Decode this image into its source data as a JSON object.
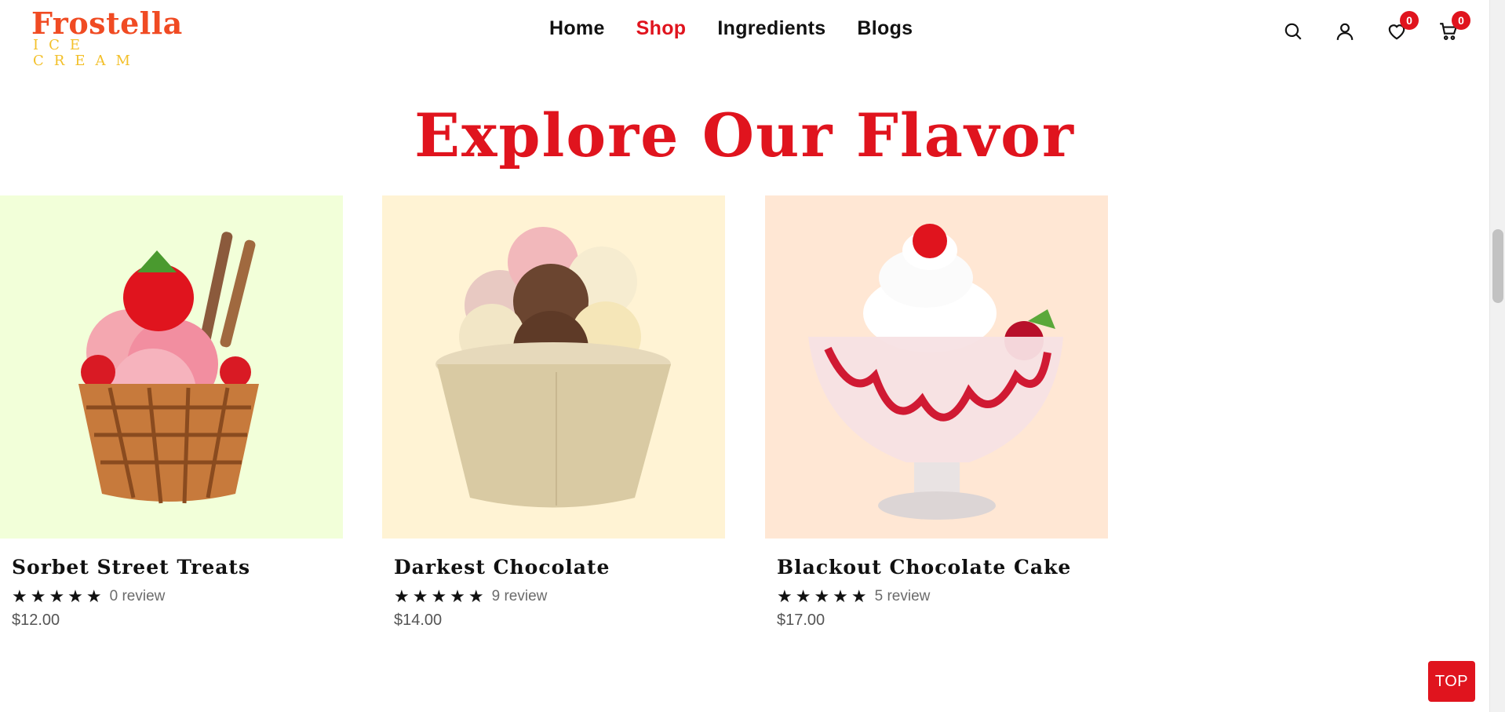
{
  "header": {
    "logo_main": "Frostella",
    "logo_sub": "ICE CREAM",
    "nav": [
      {
        "label": "Home",
        "active": false
      },
      {
        "label": "Shop",
        "active": true
      },
      {
        "label": "Ingredients",
        "active": false
      },
      {
        "label": "Blogs",
        "active": false
      }
    ],
    "tools": [
      {
        "icon": "search-icon"
      },
      {
        "icon": "user-icon"
      },
      {
        "icon": "heart-icon",
        "badge": "0"
      },
      {
        "icon": "cart-icon",
        "badge": "0"
      }
    ]
  },
  "section": {
    "title": "Explore Our Flavor"
  },
  "products": [
    {
      "title": "Sorbet Street Treats",
      "stars": "★★★★★",
      "reviews": "0 review",
      "price": "$12.00",
      "bg": "#f2ffd9"
    },
    {
      "title": "Darkest Chocolate",
      "stars": "★★★★★",
      "reviews": "9 review",
      "price": "$14.00",
      "bg": "#fff3d4"
    },
    {
      "title": "Blackout Chocolate Cake",
      "stars": "★★★★★",
      "reviews": "5 review",
      "price": "$17.00",
      "bg": "#ffe7d4"
    }
  ],
  "top_button": "TOP",
  "colors": {
    "accent": "#e0141e",
    "logo_orange": "#f04b23",
    "logo_yellow": "#f3c02a"
  }
}
